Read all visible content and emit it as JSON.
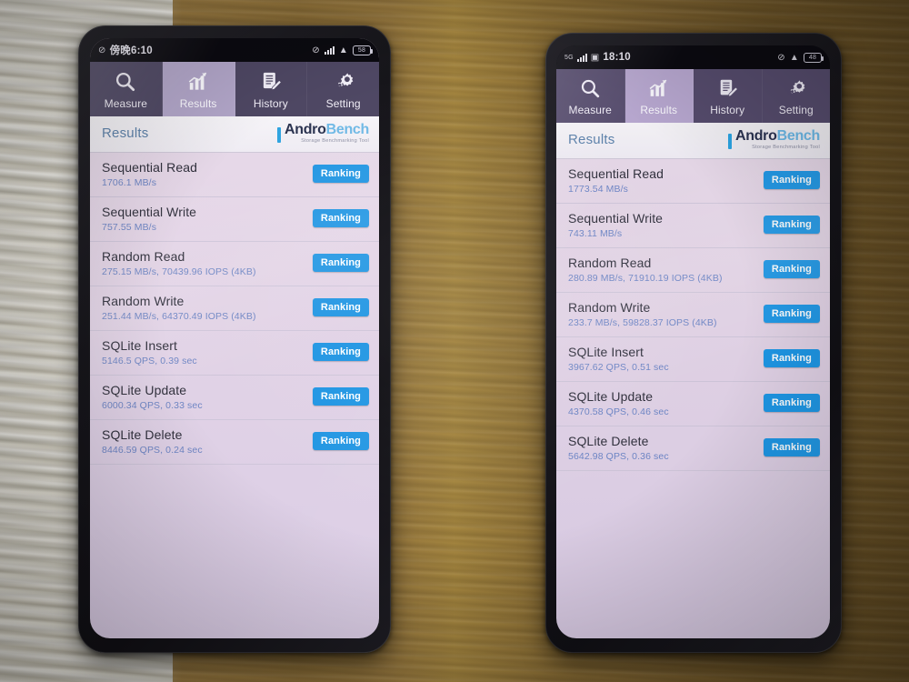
{
  "app": {
    "name": "AndroBench",
    "logo_word_a": "Andro",
    "logo_word_b": "Bench",
    "logo_subtitle": "Storage Benchmarking Tool",
    "screen_title": "Results",
    "ranking_label": "Ranking",
    "accent_blue": "#2196e3",
    "value_blue": "#6f86c4",
    "tab_bar_color": "#4e4763",
    "tab_active_color": "#b2a6c9"
  },
  "tabs": [
    {
      "label": "Measure",
      "icon": "magnifier-icon",
      "active": false
    },
    {
      "label": "Results",
      "icon": "bar-chart-icon",
      "active": true
    },
    {
      "label": "History",
      "icon": "document-pencil-icon",
      "active": false
    },
    {
      "label": "Setting",
      "icon": "gears-icon",
      "active": false
    }
  ],
  "left_phone": {
    "status": {
      "time": "傍晚6:10",
      "battery_percent": "58",
      "icons": [
        "dnd-icon",
        "mobile-signal-icon",
        "wifi-icon",
        "battery-icon"
      ]
    },
    "results": [
      {
        "name": "Sequential Read",
        "value": "1706.1 MB/s"
      },
      {
        "name": "Sequential Write",
        "value": "757.55 MB/s"
      },
      {
        "name": "Random Read",
        "value": "275.15 MB/s, 70439.96 IOPS (4KB)"
      },
      {
        "name": "Random Write",
        "value": "251.44 MB/s, 64370.49 IOPS (4KB)"
      },
      {
        "name": "SQLite Insert",
        "value": "5146.5 QPS, 0.39 sec"
      },
      {
        "name": "SQLite Update",
        "value": "6000.34 QPS, 0.33 sec"
      },
      {
        "name": "SQLite Delete",
        "value": "8446.59 QPS, 0.24 sec"
      }
    ]
  },
  "right_phone": {
    "status": {
      "time": "18:10",
      "network": "5G",
      "battery_percent": "48",
      "icons": [
        "mobile-signal-icon",
        "sim-icon",
        "dnd-icon",
        "wifi-icon",
        "battery-icon"
      ]
    },
    "results": [
      {
        "name": "Sequential Read",
        "value": "1773.54 MB/s"
      },
      {
        "name": "Sequential Write",
        "value": "743.11 MB/s"
      },
      {
        "name": "Random Read",
        "value": "280.89 MB/s, 71910.19 IOPS (4KB)"
      },
      {
        "name": "Random Write",
        "value": "233.7 MB/s, 59828.37 IOPS (4KB)"
      },
      {
        "name": "SQLite Insert",
        "value": "3967.62 QPS, 0.51 sec"
      },
      {
        "name": "SQLite Update",
        "value": "4370.58 QPS, 0.46 sec"
      },
      {
        "name": "SQLite Delete",
        "value": "5642.98 QPS, 0.36 sec"
      }
    ]
  }
}
